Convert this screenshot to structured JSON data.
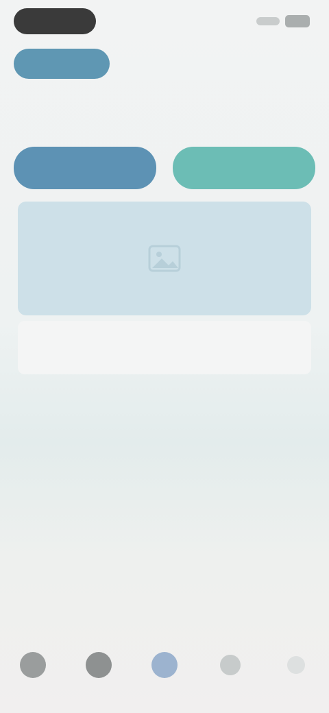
{
  "status_bar": {
    "time": "",
    "signal_icon": "signal-icon",
    "battery_icon": "battery-icon"
  },
  "tabs": [
    {
      "label": "",
      "active": true
    },
    {
      "label": "",
      "active": false
    },
    {
      "label": "",
      "active": false
    }
  ],
  "section": {
    "title": ""
  },
  "actions": {
    "primary_label": "",
    "secondary_label": ""
  },
  "preview": {
    "icon": "image-icon"
  },
  "info_card": {
    "title": "",
    "subtitle": ""
  },
  "bottom_nav": {
    "items": [
      {
        "label": "",
        "icon": "home-icon"
      },
      {
        "label": "",
        "icon": "grid-icon"
      },
      {
        "label": "",
        "icon": "camera-icon"
      },
      {
        "label": "",
        "icon": "chat-icon"
      },
      {
        "label": "",
        "icon": "profile-icon"
      }
    ]
  },
  "colors": {
    "accent_blue": "#5d92b4",
    "accent_teal": "#6cbdb5",
    "preview_bg": "#cde0e8",
    "status_pill": "#3a3a3a"
  }
}
